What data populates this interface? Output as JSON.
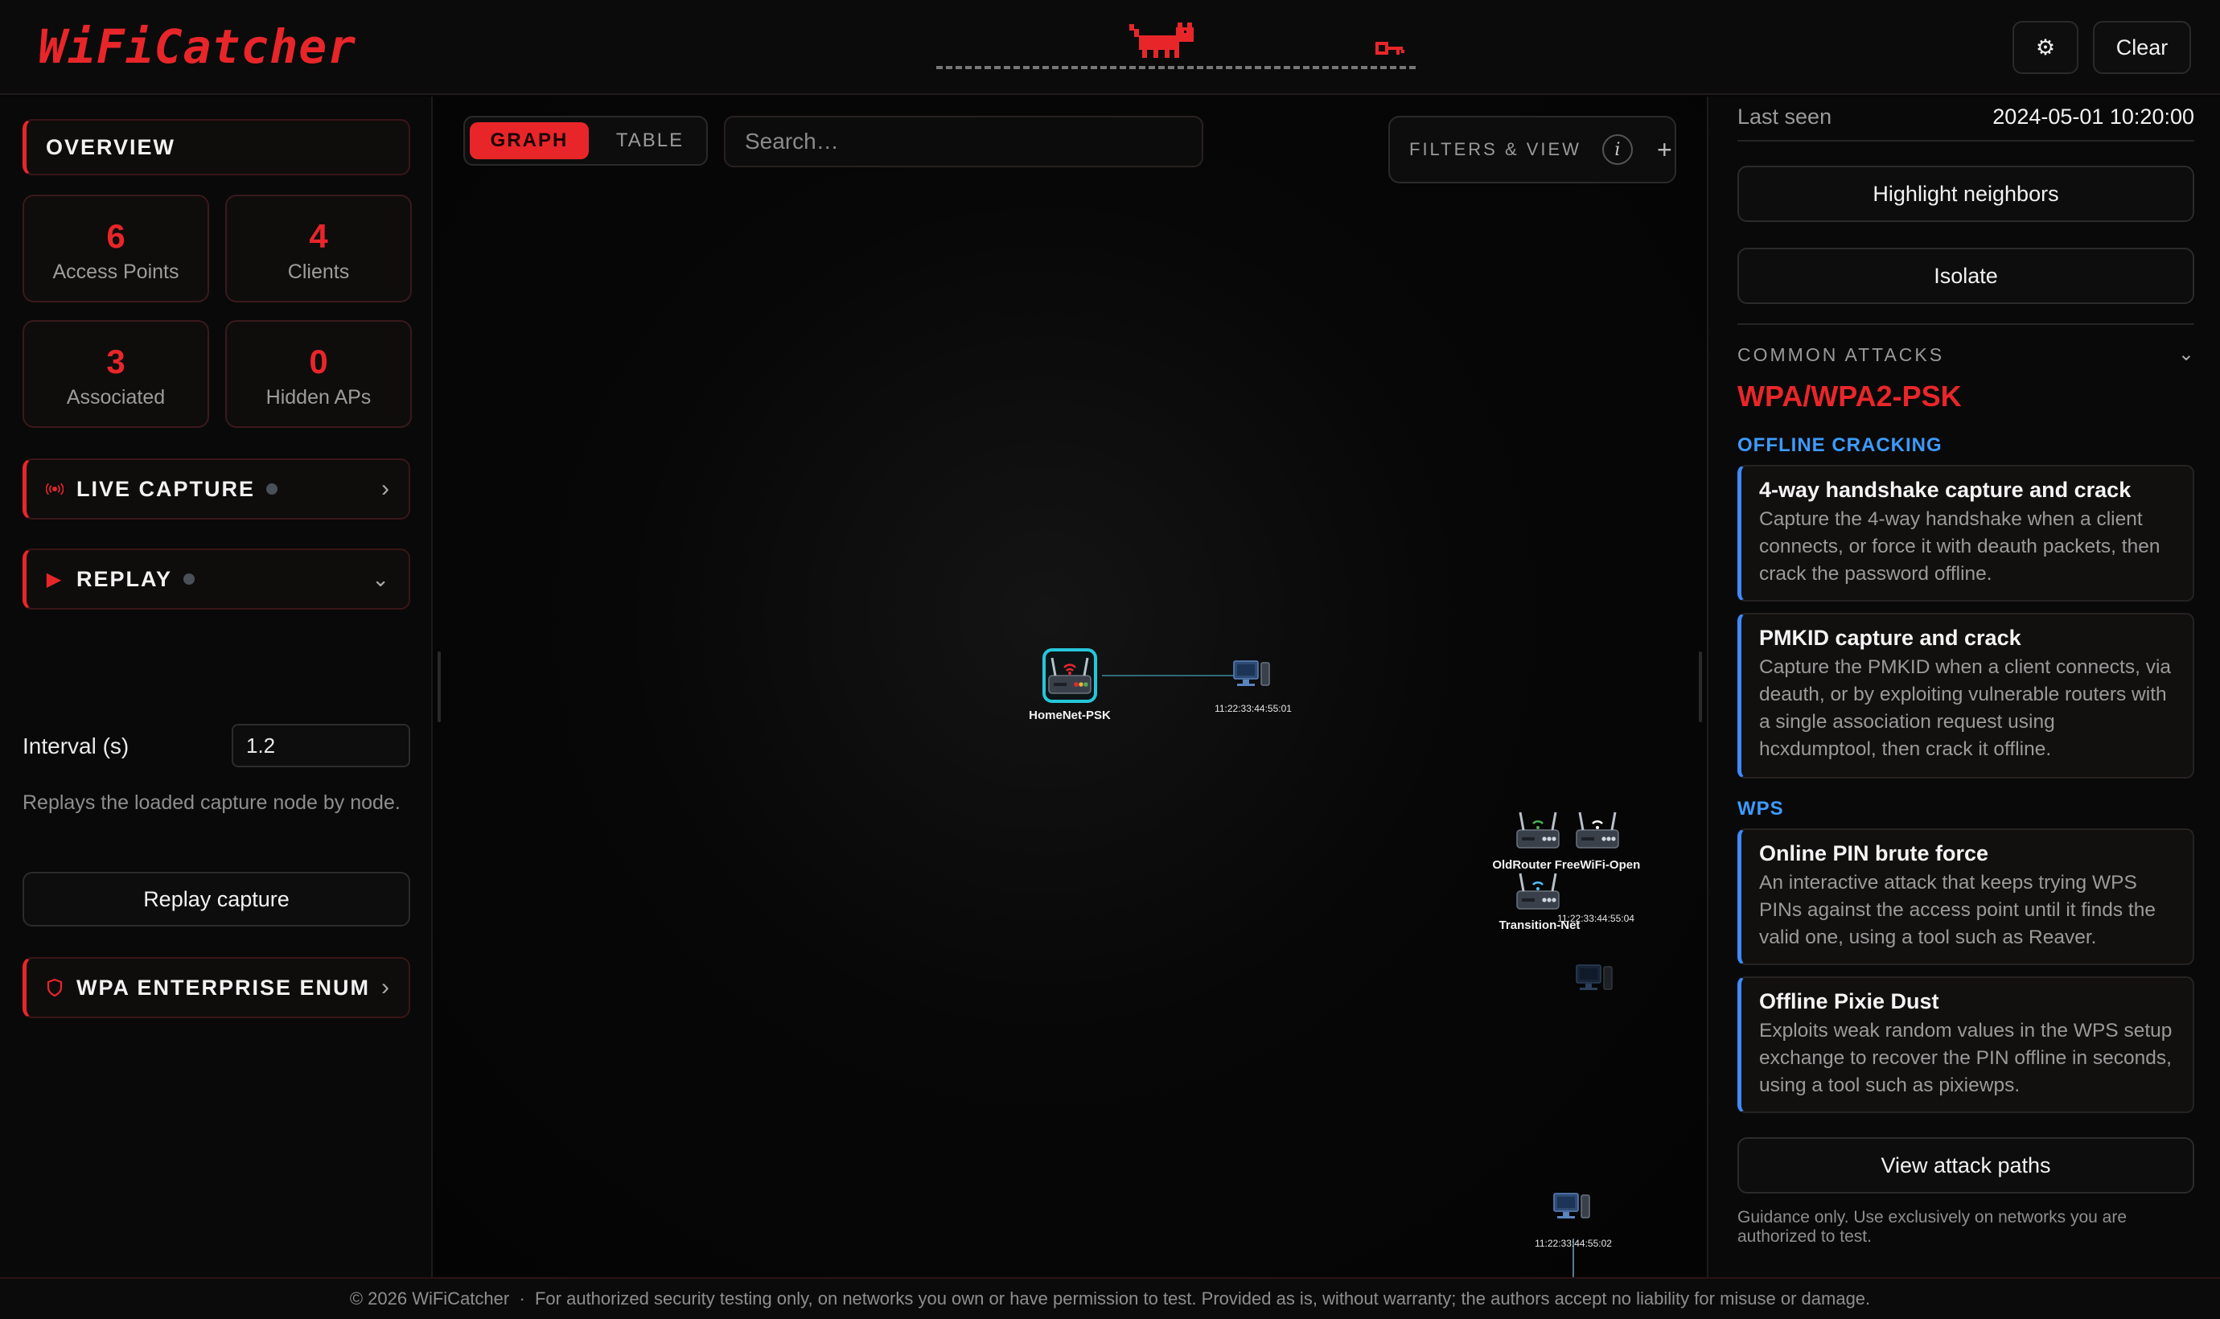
{
  "app": {
    "title": "WiFiCatcher",
    "accent_color": "#e8262a",
    "link_color": "#3d9bff"
  },
  "header": {
    "settings_icon": "⚙",
    "clear_label": "Clear"
  },
  "left": {
    "overview_label": "OVERVIEW",
    "stats": [
      {
        "value": "6",
        "label": "Access Points"
      },
      {
        "value": "4",
        "label": "Clients"
      },
      {
        "value": "3",
        "label": "Associated"
      },
      {
        "value": "0",
        "label": "Hidden APs"
      }
    ],
    "live_capture_label": "LIVE CAPTURE",
    "replay_label": "REPLAY",
    "interval_label": "Interval (s)",
    "interval_value": "1.2",
    "replay_desc": "Replays the loaded capture node by node.",
    "replay_button": "Replay capture",
    "wpa_enum_label": "WPA ENTERPRISE ENUM"
  },
  "center": {
    "tab_graph": "GRAPH",
    "tab_table": "TABLE",
    "search_placeholder": "Search…",
    "filters_label": "FILTERS & VIEW",
    "info_glyph": "i",
    "plus_glyph": "+",
    "nodes": {
      "ap_homenet": "HomeNet-PSK",
      "client_01": "11:22:33:44:55:01",
      "ap_oldrouter": "OldRouter",
      "ap_freewifi": "FreeWiFi-Open",
      "ap_transition": "Transition-Net",
      "client_04": "11:22:33:44:55:04",
      "client_02": "11:22:33:44:55:02"
    }
  },
  "right": {
    "last_seen_key": "Last seen",
    "last_seen_value": "2024-05-01 10:20:00",
    "highlight_button": "Highlight neighbors",
    "isolate_button": "Isolate",
    "common_attacks_label": "COMMON ATTACKS",
    "security_type": "WPA/WPA2-PSK",
    "groups": [
      {
        "name": "OFFLINE CRACKING",
        "attacks": [
          {
            "title": "4-way handshake capture and crack",
            "desc": "Capture the 4-way handshake when a client connects, or force it with deauth packets, then crack the password offline."
          },
          {
            "title": "PMKID capture and crack",
            "desc": "Capture the PMKID when a client connects, via deauth, or by exploiting vulnerable routers with a single association request using hcxdumptool, then crack it offline."
          }
        ]
      },
      {
        "name": "WPS",
        "attacks": [
          {
            "title": "Online PIN brute force",
            "desc": "An interactive attack that keeps trying WPS PINs against the access point until it finds the valid one, using a tool such as Reaver."
          },
          {
            "title": "Offline Pixie Dust",
            "desc": "Exploits weak random values in the WPS setup exchange to recover the PIN offline in seconds, using a tool such as pixiewps."
          }
        ]
      }
    ],
    "view_paths_button": "View attack paths",
    "guidance": "Guidance only. Use exclusively on networks you are authorized to test."
  },
  "footer": {
    "text": "© 2026 WiFiCatcher  ·  For authorized security testing only, on networks you own or have permission to test. Provided as is, without warranty; the authors accept no liability for misuse or damage."
  }
}
